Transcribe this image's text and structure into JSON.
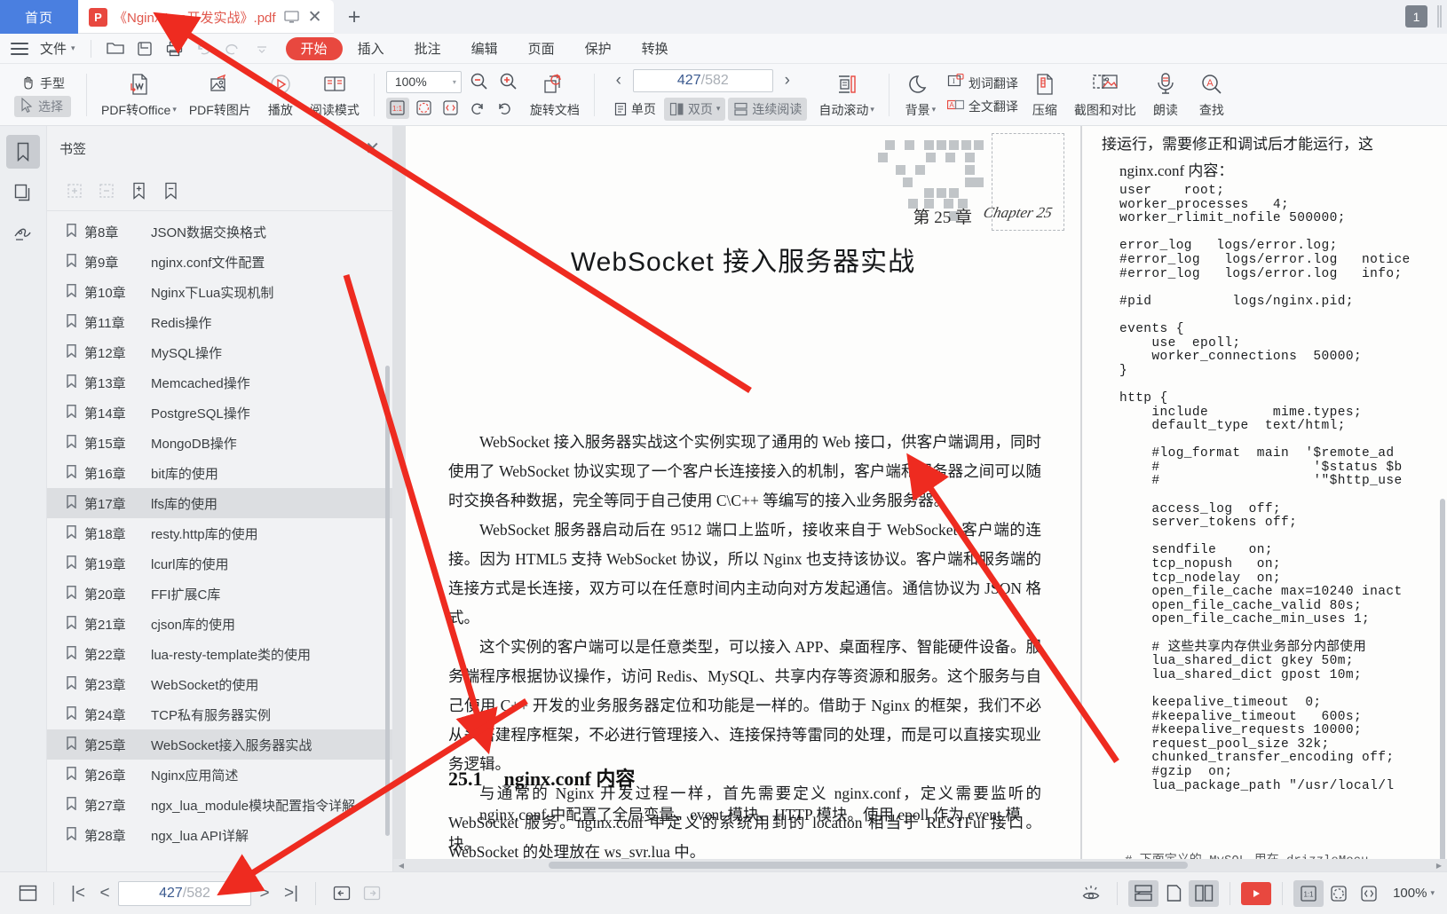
{
  "window": {
    "tab_count": "1"
  },
  "tabs": {
    "home_label": "首页",
    "doc_label": "《Nginx Lua开发实战》.pdf",
    "pdf_badge": "P",
    "new_tab_label": "+",
    "close_label": "✕",
    "present_icon": "monitor-icon"
  },
  "menu": {
    "file_label": "文件",
    "items": [
      "开始",
      "插入",
      "批注",
      "编辑",
      "页面",
      "保护",
      "转换"
    ],
    "icons": [
      "open-folder-icon",
      "save-icon",
      "print-icon",
      "undo-icon",
      "redo-icon",
      "more-icon"
    ]
  },
  "ribbon": {
    "hand_label": "手型",
    "select_label": "选择",
    "pdf_to_office": "PDF转Office",
    "pdf_to_image": "PDF转图片",
    "play": "播放",
    "read_mode": "阅读模式",
    "zoom_value": "100%",
    "zoom_out_icon": "zoom-out-icon",
    "zoom_in_icon": "zoom-in-icon",
    "fit_actual": "1:1",
    "rotate_doc": "旋转文档",
    "page_current": "427",
    "page_total": "582",
    "page_sep": "/",
    "single_page": "单页",
    "double_page": "双页",
    "continuous": "连续阅读",
    "auto_scroll": "自动滚动",
    "background": "背景",
    "word_translate": "划词翻译",
    "full_translate": "全文翻译",
    "compress": "压缩",
    "screenshot_compare": "截图和对比",
    "read_aloud": "朗读",
    "find": "查找"
  },
  "rail": {
    "items": [
      "bookmark-icon",
      "thumbnail-icon",
      "signature-icon"
    ]
  },
  "bookmarks": {
    "title": "书签",
    "close": "✕",
    "tools": [
      "expand-all-icon",
      "collapse-all-icon",
      "add-bookmark-icon",
      "remove-bookmark-icon"
    ],
    "items": [
      {
        "chapter": "第8章",
        "name": "JSON数据交换格式",
        "selected": false
      },
      {
        "chapter": "第9章",
        "name": "nginx.conf文件配置",
        "selected": false
      },
      {
        "chapter": "第10章",
        "name": "Nginx下Lua实现机制",
        "selected": false
      },
      {
        "chapter": "第11章",
        "name": "Redis操作",
        "selected": false
      },
      {
        "chapter": "第12章",
        "name": "MySQL操作",
        "selected": false
      },
      {
        "chapter": "第13章",
        "name": "Memcached操作",
        "selected": false
      },
      {
        "chapter": "第14章",
        "name": "PostgreSQL操作",
        "selected": false
      },
      {
        "chapter": "第15章",
        "name": "MongoDB操作",
        "selected": false
      },
      {
        "chapter": "第16章",
        "name": "bit库的使用",
        "selected": false
      },
      {
        "chapter": "第17章",
        "name": "lfs库的使用",
        "selected": true
      },
      {
        "chapter": "第18章",
        "name": "resty.http库的使用",
        "selected": false
      },
      {
        "chapter": "第19章",
        "name": "lcurl库的使用",
        "selected": false
      },
      {
        "chapter": "第20章",
        "name": "FFI扩展C库",
        "selected": false
      },
      {
        "chapter": "第21章",
        "name": "cjson库的使用",
        "selected": false
      },
      {
        "chapter": "第22章",
        "name": "lua-resty-template类的使用",
        "selected": false
      },
      {
        "chapter": "第23章",
        "name": "WebSocket的使用",
        "selected": false
      },
      {
        "chapter": "第24章",
        "name": "TCP私有服务器实例",
        "selected": false
      },
      {
        "chapter": "第25章",
        "name": "WebSocket接入服务器实战",
        "selected": true
      },
      {
        "chapter": "第26章",
        "name": "Nginx应用简述",
        "selected": false
      },
      {
        "chapter": "第27章",
        "name": "ngx_lua_module模块配置指令详解",
        "selected": false
      },
      {
        "chapter": "第28章",
        "name": "ngx_lua API详解",
        "selected": false
      }
    ]
  },
  "document": {
    "chapter_no": "第 25 章",
    "chapter_en": "Chapter 25",
    "chapter_title": "WebSocket 接入服务器实战",
    "para1": "WebSocket 接入服务器实战这个实例实现了通用的 Web 接口，供客户端调用，同时使用了 WebSocket 协议实现了一个客户长连接接入的机制，客户端和服务器之间可以随时交换各种数据，完全等同于自己使用 C\\C++ 等编写的接入业务服务器。",
    "para2": "WebSocket 服务器启动后在 9512 端口上监听，接收来自于 WebSocket 客户端的连接。因为 HTML5 支持 WebSocket 协议，所以 Nginx 也支持该协议。客户端和服务端的连接方式是长连接，双方可以在任意时间内主动向对方发起通信。通信协议为 JSON 格式。",
    "para3": "这个实例的客户端可以是任意类型，可以接入 APP、桌面程序、智能硬件设备。服务端程序根据协议操作，访问 Redis、MySQL、共享内存等资源和服务。这个服务与自己使用 C++ 开发的业务服务器定位和功能是一样的。借助于 Nginx 的框架，我们不必从头搭建程序框架，不必进行管理接入、连接保持等雷同的处理，而是可以直接实现业务逻辑。",
    "para4": "与通常的 Nginx 开发过程一样，首先需要定义 nginx.conf，定义需要监听的 WebSocket 服务。nginx.conf 中定义的系统用到的 location 相当于 RESTFul 接口。WebSocket 的处理放在 ws_svr.lua 中。",
    "section_num": "25.1",
    "section_title": "nginx.conf 内容",
    "section_body": "nginx.conf 中配置了全局变量、event 模块、HTTP 模块。使用 epoll 作为 event 模块。",
    "right_top": "接运行，需要修正和调试后才能运行，这",
    "right_sub": "nginx.conf 内容：",
    "right_code": "user    root;\nworker_processes   4;\nworker_rlimit_nofile 500000;\n\nerror_log   logs/error.log;\n#error_log   logs/error.log   notice\n#error_log   logs/error.log   info;\n\n#pid          logs/nginx.pid;\n\nevents {\n    use  epoll;\n    worker_connections  50000;\n}\n\nhttp {\n    include        mime.types;\n    default_type  text/html;\n\n    #log_format  main  '$remote_ad\n    #                   '$status $b\n    #                   '\"$http_use\n\n    access_log  off;\n    server_tokens off;\n\n    sendfile    on;\n    tcp_nopush   on;\n    tcp_nodelay  on;\n    open_file_cache max=10240 inact\n    open_file_cache_valid 80s;\n    open_file_cache_min_uses 1;\n\n    # 这些共享内存供业务部分内部使用\n    lua_shared_dict gkey 50m;\n    lua_shared_dict gpost 10m;\n\n    keepalive_timeout  0;\n    #keepalive_timeout   600s;\n    #keepalive_requests 10000;\n    request_pool_size 32k;\n    chunked_transfer_encoding off;\n    #gzip  on;\n    lua_package_path \"/usr/local/l",
    "right_footer": "# 下面定义的 MySQL 用在 drizzleMocu"
  },
  "status": {
    "panel_icon": "layout-panel-icon",
    "first_page": "|<",
    "prev_page": "<",
    "page_current": "427",
    "page_sep": "/",
    "page_total": "582",
    "next_page": ">",
    "last_page": ">|",
    "back_icon": "nav-back-icon",
    "forward_icon": "nav-forward-icon",
    "eye_icon": "eye-protect-icon",
    "continuous_icon": "continuous-view-icon",
    "single_icon": "single-page-icon",
    "double_icon": "double-page-icon",
    "play_icon": "slideshow-icon",
    "fit_actual": "1:1",
    "fit_page_icon": "fit-page-icon",
    "fit_width_icon": "fit-width-icon",
    "zoom_value": "100%"
  },
  "colors": {
    "accent_red": "#e8483f",
    "home_blue": "#4a7fe0",
    "tab_title_red": "#e0574c",
    "annotation_red": "#ee2b20"
  }
}
